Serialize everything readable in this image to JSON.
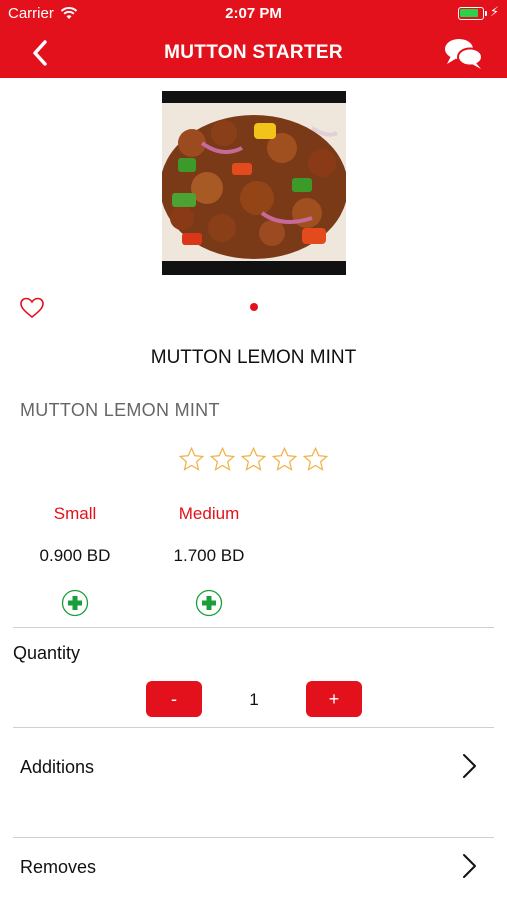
{
  "status_bar": {
    "carrier": "Carrier",
    "time": "2:07 PM"
  },
  "header": {
    "title": "MUTTON STARTER",
    "back_icon": "chevron-left-icon",
    "chat_icon": "chat-bubbles-icon"
  },
  "product": {
    "name_center": "MUTTON LEMON MINT",
    "name_left": "MUTTON LEMON MINT",
    "rating": 0,
    "rating_max": 5
  },
  "sizes": [
    {
      "label": "Small",
      "price": "0.900 BD"
    },
    {
      "label": "Medium",
      "price": "1.700 BD"
    }
  ],
  "quantity": {
    "label": "Quantity",
    "minus": "-",
    "value": "1",
    "plus": "+"
  },
  "options": {
    "additions_label": "Additions",
    "removes_label": "Removes"
  },
  "colors": {
    "brand_red": "#e3111b",
    "add_green": "#1a9e3a",
    "star_outline": "#f0b24a"
  }
}
